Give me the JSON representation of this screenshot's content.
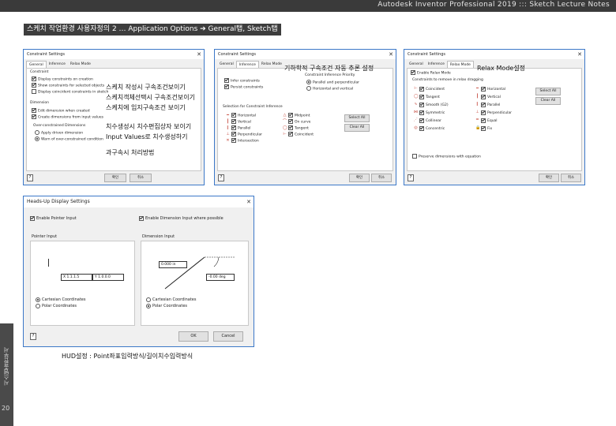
{
  "header": {
    "title": "Autodesk Inventor Professional 2019 ::: Sketch Lecture Notes"
  },
  "section_title": "스케치 작업환경 사용자정의 2 … Application Options ➔ General탭, Sketch탭",
  "sidebar": {
    "text": "시스템출판부서",
    "page": "20"
  },
  "annotations": {
    "a1": "스케치 작성시 구속조건보이기",
    "a2": "스케치객체선택시 구속조건보이기",
    "a3": "스케치에 임지구속조건 보이기",
    "a4": "치수생성시 치수편집상자 보이기",
    "a5": "Input Values로 치수생성하기",
    "a6": "과구속시 처리방법",
    "a7": "기하학적 구속조건 자동 추론 설정",
    "a8": "Relax Mode설정"
  },
  "caption": "HUD설정 : Point좌표입력방식/길이치수입력방식",
  "dialog1": {
    "title": "Constraint Settings",
    "tabs": [
      "General",
      "Inference",
      "Relax Mode"
    ],
    "constraint_group": "Constraint",
    "constraint_rows": [
      "Display constraints on creation",
      "Show constraints for selected objects",
      "Display coincident constraints in sketch"
    ],
    "dimension_group": "Dimension",
    "dimension_rows": [
      "Edit dimension when created",
      "Create dimensions from input values"
    ],
    "over_group": "Over-constrained Dimensions",
    "over_rows": [
      "Apply driven dimension",
      "Warn of over-constrained condition"
    ],
    "ok": "확인",
    "cancel": "취소"
  },
  "dialog2": {
    "title": "Constraint Settings",
    "tabs": [
      "General",
      "Inference",
      "Relax Mode"
    ],
    "infer_rows": [
      "Infer constraints",
      "Persist constraints"
    ],
    "priority_group": "Constraint Inference Priority",
    "priority_rows": [
      "Parallel and perpendicular",
      "Horizontal and vertical"
    ],
    "selection_group": "Selection for Constraint Inference",
    "left_col": [
      "Horizontal",
      "Vertical",
      "Parallel",
      "Perpendicular",
      "Intersection"
    ],
    "right_col": [
      "Midpoint",
      "On curve",
      "Tangent",
      "Coincident"
    ],
    "select_all": "Select All",
    "clear_all": "Clear All",
    "ok": "확인",
    "cancel": "취소"
  },
  "dialog3": {
    "title": "Constraint Settings",
    "tabs": [
      "General",
      "Inference",
      "Relax Mode"
    ],
    "enable": "Enable Relax Mode",
    "group": "Constraints to remove in relax dragging",
    "left_col": [
      "Coincident",
      "Tangent",
      "Smooth (G2)",
      "Symmetric",
      "Collinear",
      "Concentric"
    ],
    "right_col": [
      "Horizontal",
      "Vertical",
      "Parallel",
      "Perpendicular",
      "Equal",
      "Fix"
    ],
    "select_all": "Select All",
    "clear_all": "Clear All",
    "preserve": "Preserve dimensions with equation",
    "ok": "확인",
    "cancel": "취소"
  },
  "hud": {
    "title": "Heads-Up Display Settings",
    "enable_pointer": "Enable Pointer Input",
    "enable_dimension": "Enable Dimension Input where possible",
    "pointer_group": "Pointer Input",
    "dimension_group": "Dimension Input",
    "x_value": "X 1.1.1.5",
    "y_value": "Y 1.0.0.0",
    "len_value": "0.000 in",
    "ang_value": "-0.00 deg",
    "pointer_opts": [
      "Cartesian Coordinates",
      "Polar Coordinates"
    ],
    "dim_opts": [
      "Cartesian Coordinates",
      "Polar Coordinates"
    ],
    "ok": "OK",
    "cancel": "Cancel"
  }
}
